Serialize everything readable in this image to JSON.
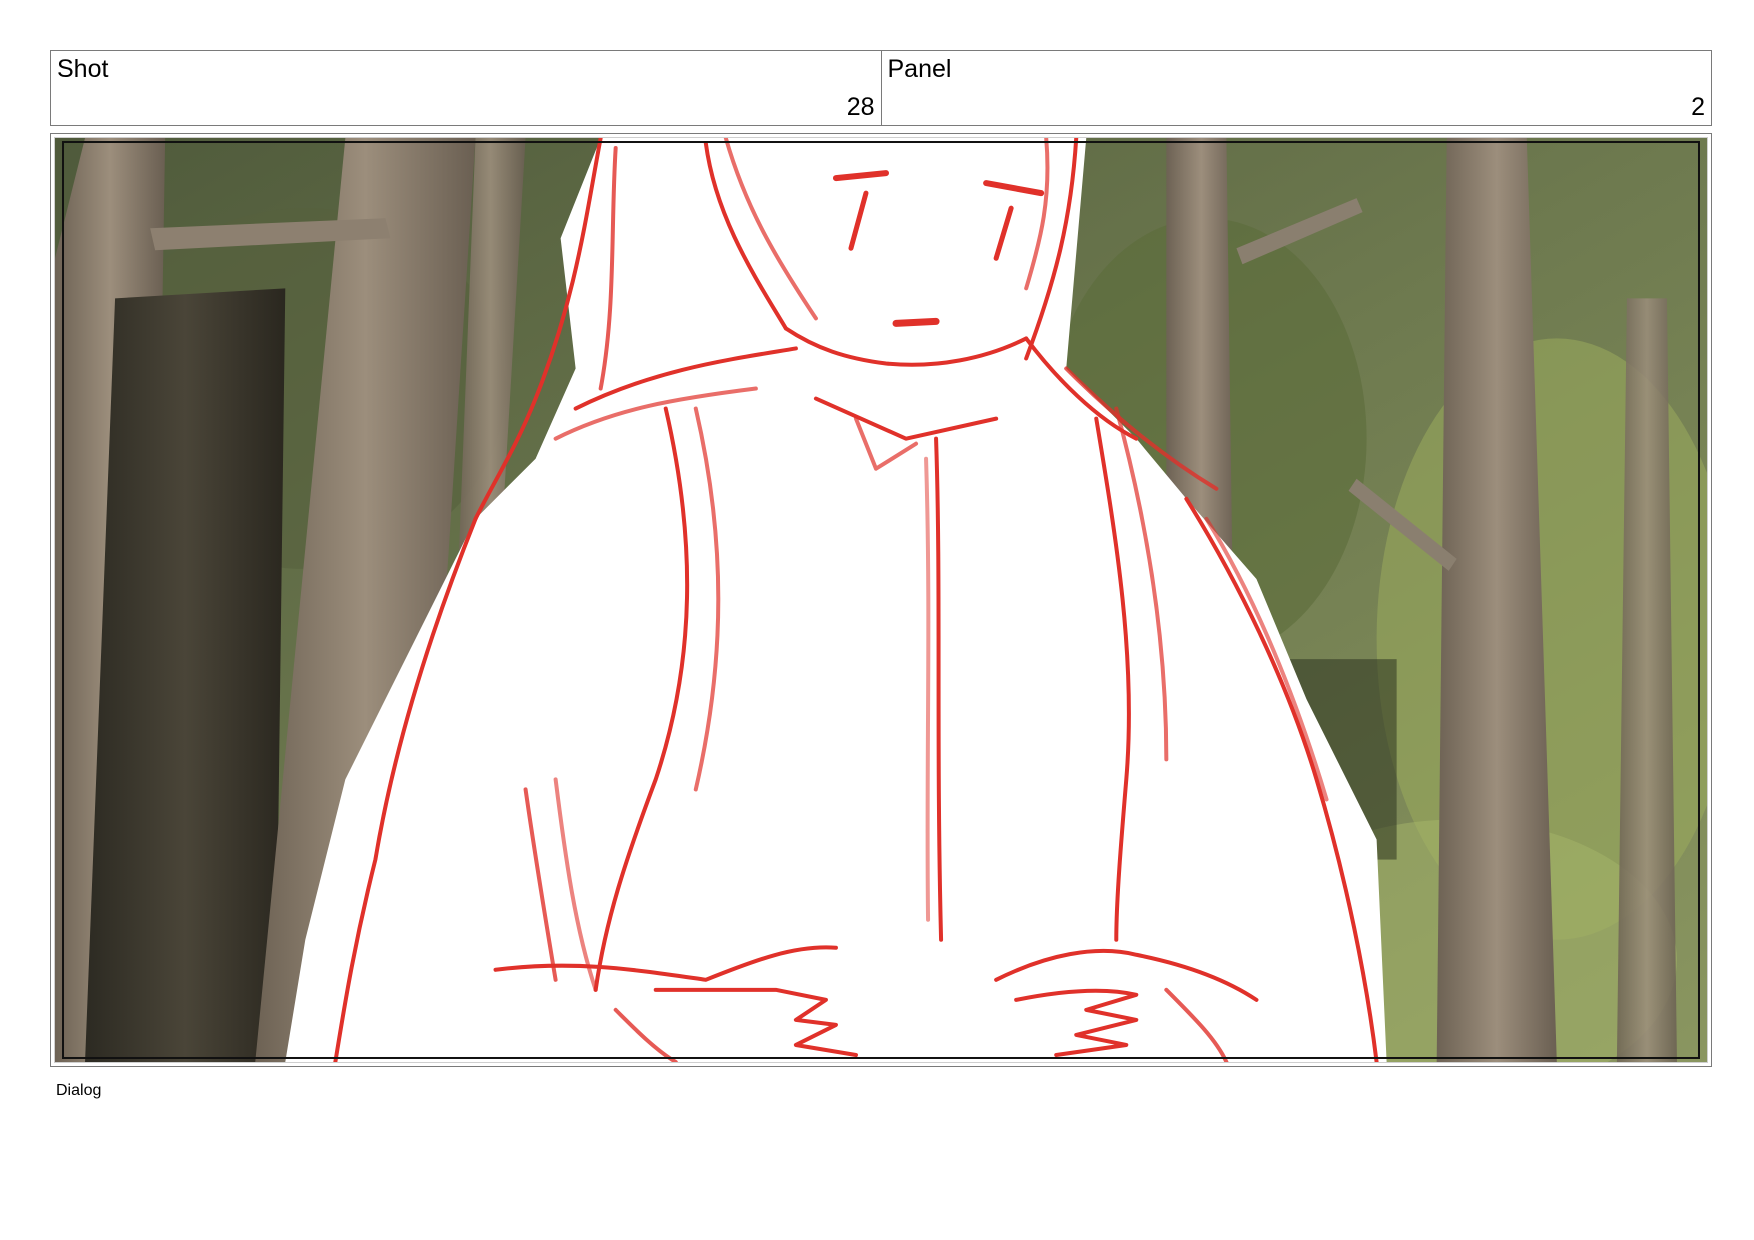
{
  "header": {
    "shot_label": "Shot",
    "shot_number": "28",
    "panel_label": "Panel",
    "panel_number": "2"
  },
  "panel": {
    "background": "forest-photo",
    "sketch_color": "#e0312a",
    "subject": "character-sketch"
  },
  "dialog": {
    "label": "Dialog"
  }
}
